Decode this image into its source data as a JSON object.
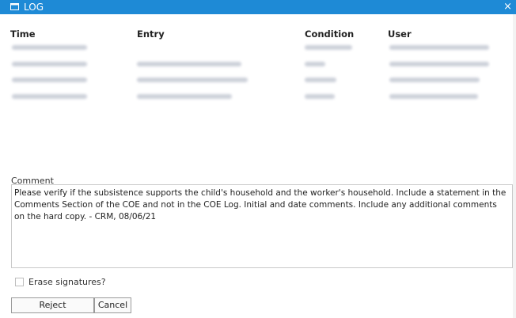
{
  "window": {
    "title": "LOG",
    "close_glyph": "×",
    "icon": "window-icon",
    "accent": "#1e8ad6"
  },
  "table": {
    "columns": [
      "Time",
      "Entry",
      "Condition",
      "User"
    ],
    "rows_note": "row cell text is blurred/illegible in the screenshot",
    "row_count": 4
  },
  "comment": {
    "label": "Comment",
    "text": "Please verify if the subsistence supports the child's household and the worker's household. Include a statement in the Comments Section of the COE and not in the COE Log. Initial and date comments. Include any additional comments on the hard copy. - CRM, 08/06/21"
  },
  "erase": {
    "label": "Erase signatures?",
    "checked": false
  },
  "buttons": {
    "reject": "Reject",
    "cancel": "Cancel"
  }
}
